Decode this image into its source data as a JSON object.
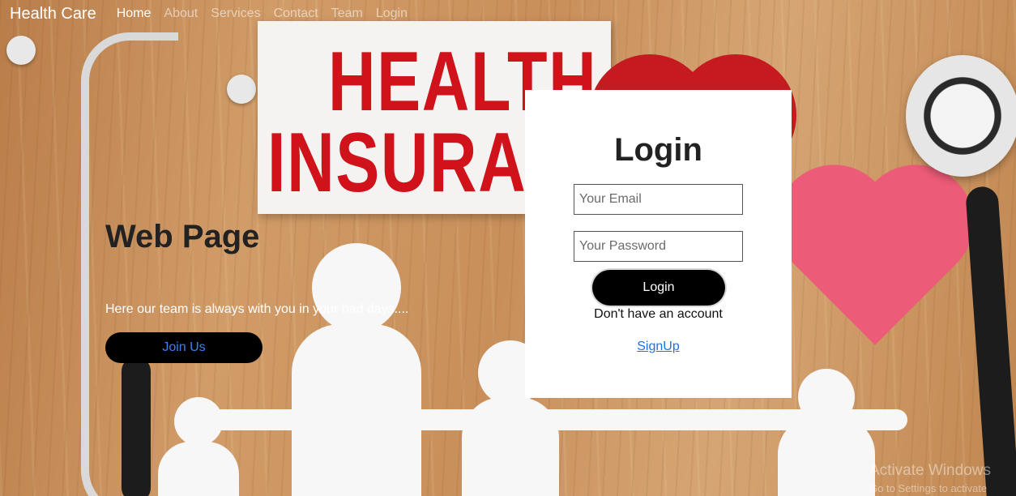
{
  "nav": {
    "brand": "Health Care",
    "links": [
      "Home",
      "About",
      "Services",
      "Contact",
      "Team",
      "Login"
    ],
    "active": "Home"
  },
  "background": {
    "sign_line1": "HEALTH",
    "sign_line2": "INSURAN"
  },
  "hero": {
    "title": "Web Page",
    "subtitle": "Here our team is always with you in your bad days....",
    "join_label": "Join Us"
  },
  "login": {
    "title": "Login",
    "email_placeholder": "Your Email",
    "password_placeholder": "Your Password",
    "button_label": "Login",
    "no_account_text": "Don't have an account",
    "signup_label": "SignUp"
  },
  "watermark": {
    "line1": "Activate Windows",
    "line2": "Go to Settings to activate Windows."
  },
  "colors": {
    "accent_link": "#1a73e8",
    "button_bg": "#000000",
    "sign_red": "#d0121b"
  }
}
